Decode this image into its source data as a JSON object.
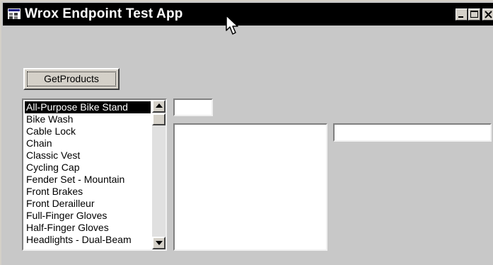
{
  "window": {
    "title": "Wrox Endpoint Test App",
    "controls": [
      "minimize-icon",
      "maximize-icon",
      "close-icon"
    ],
    "background": "#c8c8c8",
    "titlebar_color": "#000000"
  },
  "toolbar": {
    "get_products_label": "GetProducts"
  },
  "products": {
    "selected_index": 0,
    "items": [
      "All-Purpose Bike Stand",
      "Bike Wash",
      "Cable Lock",
      "Chain",
      "Classic Vest",
      "Cycling Cap",
      "Fender Set - Mountain",
      "Front Brakes",
      "Front Derailleur",
      "Full-Finger Gloves",
      "Half-Finger Gloves",
      "Headlights - Dual-Beam"
    ],
    "scroll_position": 0
  },
  "fields": {
    "small_input_value": "",
    "detail_text": "",
    "wide_input_value": ""
  }
}
